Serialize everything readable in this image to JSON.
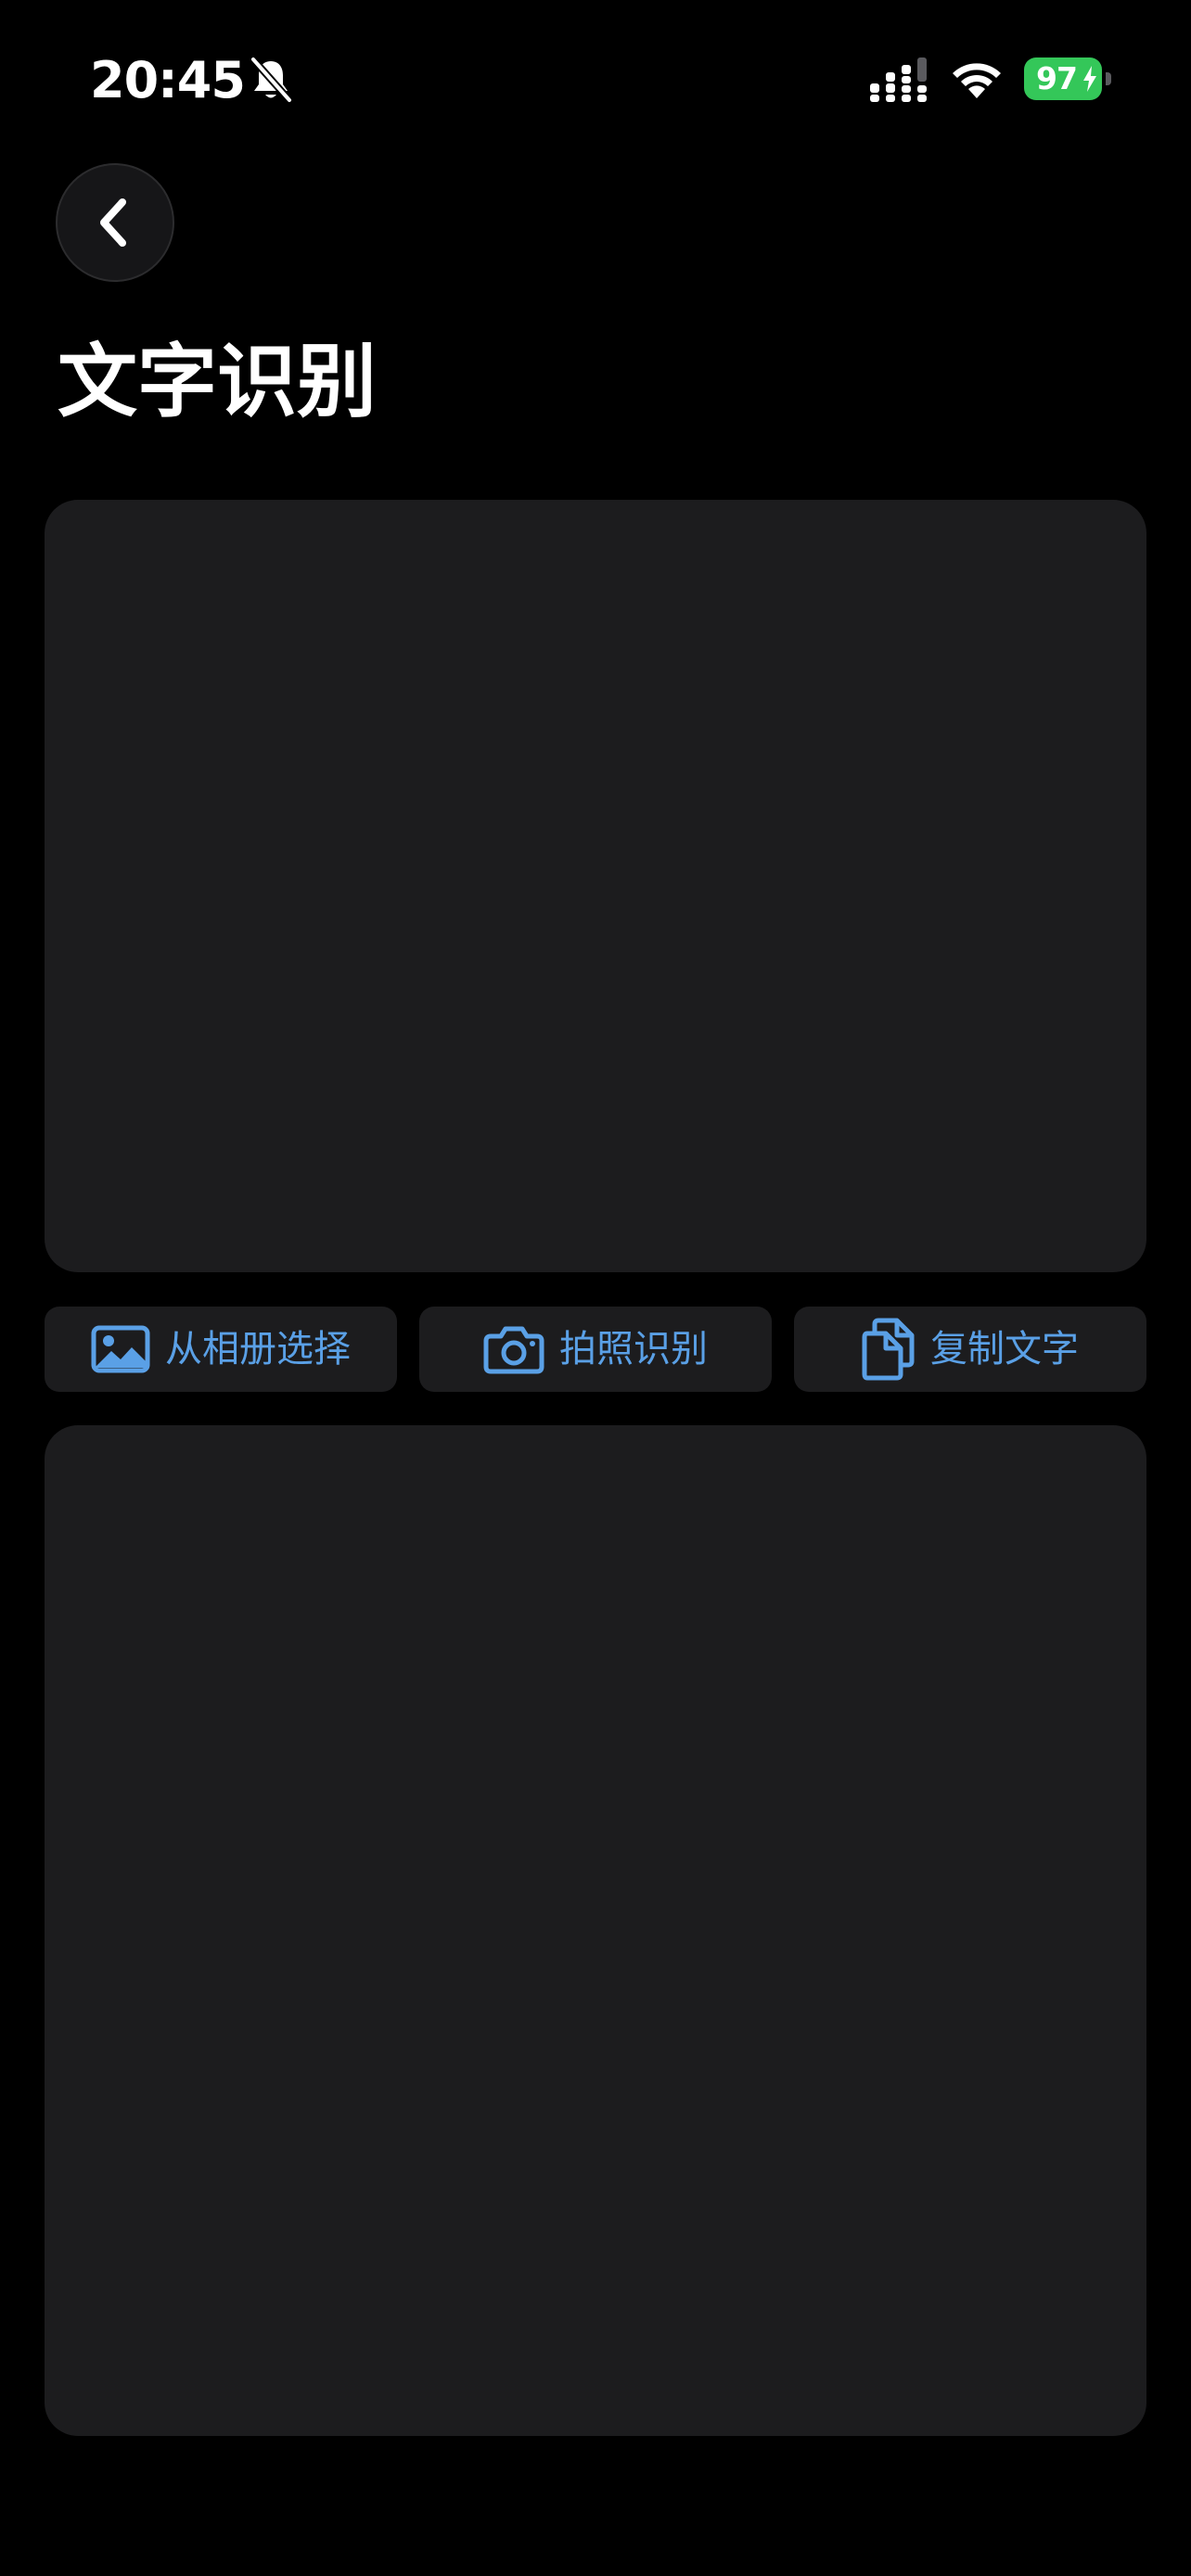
{
  "status_bar": {
    "time": "20:45",
    "battery": "97",
    "icons": [
      "bell-slash-icon",
      "cellular-signal-icon",
      "wifi-icon",
      "battery-charging-icon"
    ]
  },
  "nav": {
    "back_icon": "chevron-left-icon"
  },
  "page": {
    "title": "文字识别"
  },
  "actions": [
    {
      "label": "从相册选择",
      "icon": "photo-icon"
    },
    {
      "label": "拍照识别",
      "icon": "camera-icon"
    },
    {
      "label": "复制文字",
      "icon": "copy-document-icon"
    }
  ],
  "colors": {
    "background": "#000000",
    "panel": "#1c1c1e",
    "accent": "#5aa0e6",
    "battery": "#34c759"
  }
}
